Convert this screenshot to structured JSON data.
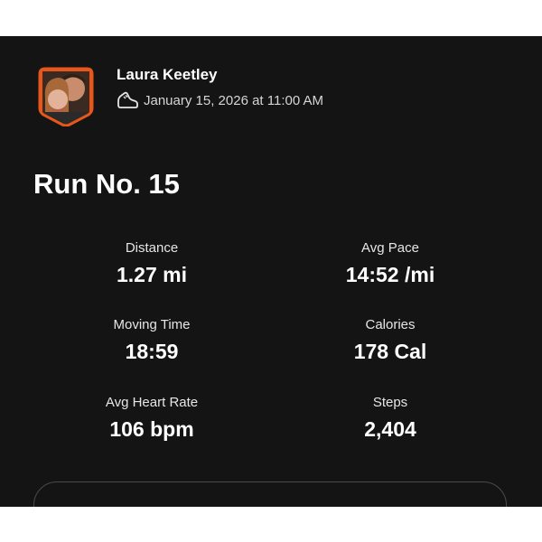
{
  "activity": {
    "user_name": "Laura Keetley",
    "date": "January 15, 2026 at 11:00 AM",
    "title": "Run No. 15",
    "activity_icon": "running-shoe-icon",
    "accent_color": "#e8561a"
  },
  "stats": [
    {
      "label": "Distance",
      "value": "1.27 mi"
    },
    {
      "label": "Avg Pace",
      "value": "14:52 /mi"
    },
    {
      "label": "Moving Time",
      "value": "18:59"
    },
    {
      "label": "Calories",
      "value": "178 Cal"
    },
    {
      "label": "Avg Heart Rate",
      "value": "106 bpm"
    },
    {
      "label": "Steps",
      "value": "2,404"
    }
  ]
}
